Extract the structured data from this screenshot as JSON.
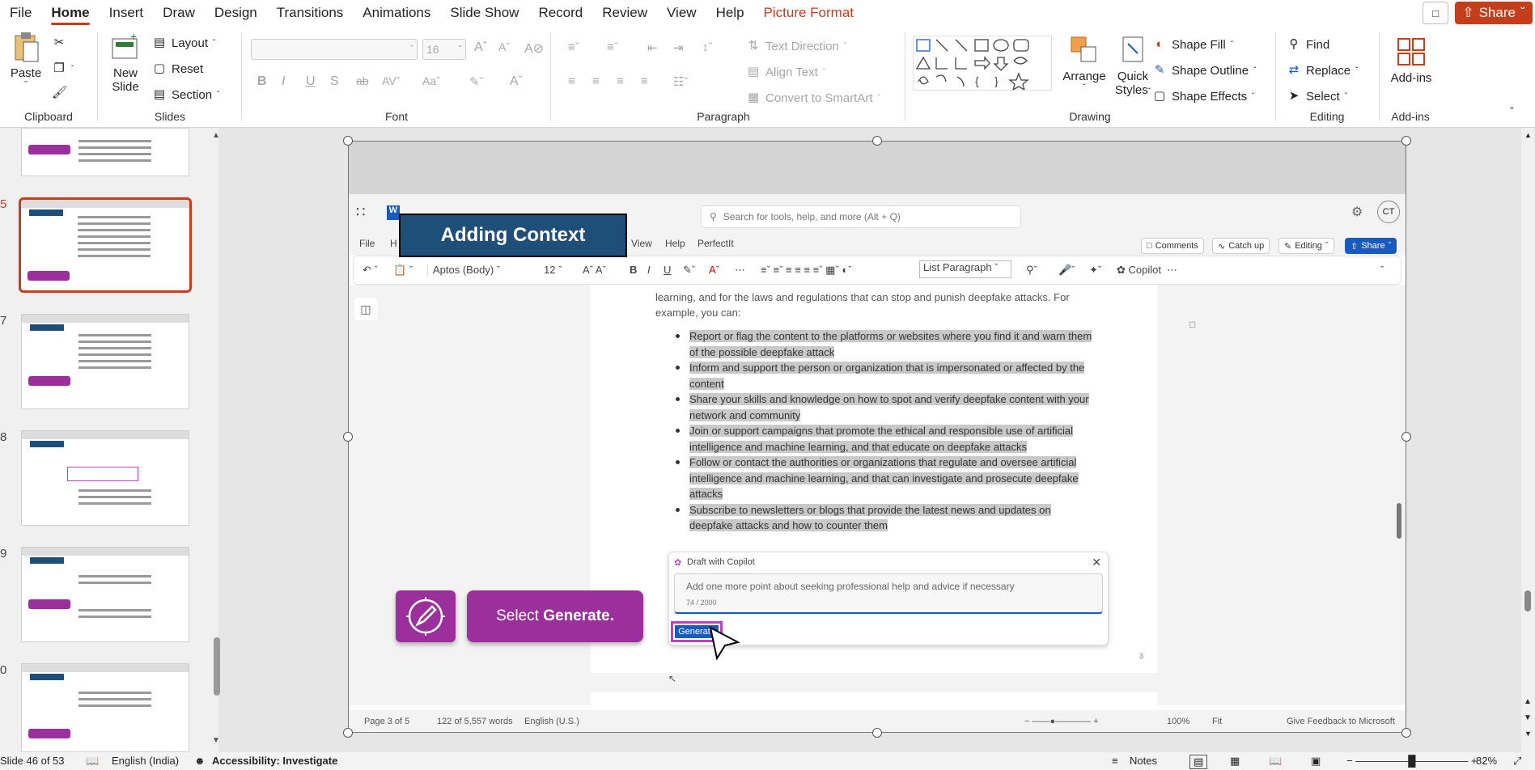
{
  "menu": {
    "tabs": [
      "File",
      "Home",
      "Insert",
      "Draw",
      "Design",
      "Transitions",
      "Animations",
      "Slide Show",
      "Record",
      "Review",
      "View",
      "Help",
      "Picture Format"
    ],
    "share": "Share"
  },
  "ribbon": {
    "clipboard": {
      "paste": "Paste",
      "label": "Clipboard"
    },
    "slides": {
      "new_slide": "New Slide",
      "layout": "Layout",
      "reset": "Reset",
      "section": "Section",
      "label": "Slides"
    },
    "font": {
      "font_name": "",
      "font_size": "16",
      "label": "Font"
    },
    "paragraph": {
      "text_direction": "Text Direction",
      "align_text": "Align Text",
      "convert": "Convert to SmartArt",
      "label": "Paragraph"
    },
    "drawing": {
      "arrange": "Arrange",
      "quick_styles": "Quick Styles",
      "shape_fill": "Shape Fill",
      "shape_outline": "Shape Outline",
      "shape_effects": "Shape Effects",
      "label": "Drawing"
    },
    "editing": {
      "find": "Find",
      "replace": "Replace",
      "select": "Select",
      "label": "Editing"
    },
    "addins": {
      "btn": "Add-ins",
      "label": "Add-ins"
    }
  },
  "thumbs": [
    {
      "num": "",
      "title": ""
    },
    {
      "num": "5",
      "title": "Adding Context"
    },
    {
      "num": "7",
      "title": "Adding Context"
    },
    {
      "num": "8",
      "title": "Refining the Title"
    },
    {
      "num": "9",
      "title": "Refining the Title"
    },
    {
      "num": "0",
      "title": "Refining the Title"
    }
  ],
  "word": {
    "search": "Search for tools, help, and more (Alt + Q)",
    "tabs": [
      "File",
      "H",
      "View",
      "Help",
      "PerfectIt"
    ],
    "comments": "Comments",
    "catchup": "Catch up",
    "editing": "Editing",
    "share": "Share",
    "font": "Aptos (Body)",
    "size": "12",
    "style": "List Paragraph",
    "copilot": "Copilot",
    "para": "learning, and for the laws and regulations that can stop and punish deepfake attacks. For example, you can:",
    "bullets": [
      "Report or flag the content to the platforms or websites where you find it and warn them of the possible deepfake attack",
      "Inform and support the person or organization that is impersonated or affected by the content",
      "Share your skills and knowledge on how to spot and verify deepfake content with your network and community",
      "Join or support campaigns that promote the ethical and responsible use of artificial intelligence and machine learning, and that educate on deepfake attacks",
      "Follow or contact the authorities or organizations that regulate and oversee artificial intelligence and machine learning, and that can investigate and prosecute deepfake attacks",
      "Subscribe to newsletters or blogs that provide the latest news and updates on deepfake attacks and how to counter them"
    ],
    "copilot_title": "Draft with Copilot",
    "copilot_prompt": "Add one more point about seeking professional help and advice if necessary",
    "copilot_count": "74 / 2000",
    "generate": "Generate",
    "page_num": "3",
    "status_page": "Page 3 of 5",
    "status_words": "122 of 5,557 words",
    "status_lang": "English (U.S.)",
    "status_zoom": "100%",
    "status_fit": "Fit",
    "status_feedback": "Give Feedback to Microsoft"
  },
  "slide": {
    "title": "Adding Context",
    "callout_pre": "Select ",
    "callout_bold": "Generate."
  },
  "status": {
    "slide": "Slide 46 of 53",
    "lang": "English (India)",
    "access": "Accessibility: Investigate",
    "notes": "Notes",
    "zoom": "82%"
  },
  "colors": {
    "accent": "#c43e1c",
    "callout": "#9b2f9b",
    "title_bg": "#1f4e79",
    "word_blue": "#185abd"
  }
}
